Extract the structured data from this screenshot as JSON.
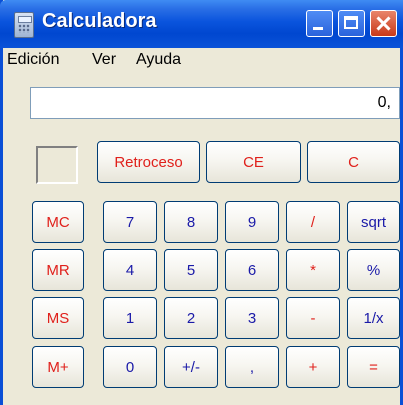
{
  "window": {
    "title": "Calculadora"
  },
  "menu": [
    "Edición",
    "Ver",
    "Ayuda"
  ],
  "display": {
    "value": "0,"
  },
  "colors": {
    "title_bar": "#0a54dd",
    "window_bg": "#ece9d8",
    "red_text": "#e0201b",
    "blue_text": "#1a1aa8"
  },
  "top_buttons": [
    {
      "label": "Retroceso"
    },
    {
      "label": "CE"
    },
    {
      "label": "C"
    }
  ],
  "memory_buttons": [
    {
      "label": "MC"
    },
    {
      "label": "MR"
    },
    {
      "label": "MS"
    },
    {
      "label": "M+"
    }
  ],
  "keypad": [
    [
      {
        "label": "7"
      },
      {
        "label": "8"
      },
      {
        "label": "9"
      },
      {
        "label": "/"
      },
      {
        "label": "sqrt"
      }
    ],
    [
      {
        "label": "4"
      },
      {
        "label": "5"
      },
      {
        "label": "6"
      },
      {
        "label": "*"
      },
      {
        "label": "%"
      }
    ],
    [
      {
        "label": "1"
      },
      {
        "label": "2"
      },
      {
        "label": "3"
      },
      {
        "label": "-"
      },
      {
        "label": "1/x"
      }
    ],
    [
      {
        "label": "0"
      },
      {
        "label": "+/-"
      },
      {
        "label": ","
      },
      {
        "label": "+"
      },
      {
        "label": "="
      }
    ]
  ]
}
